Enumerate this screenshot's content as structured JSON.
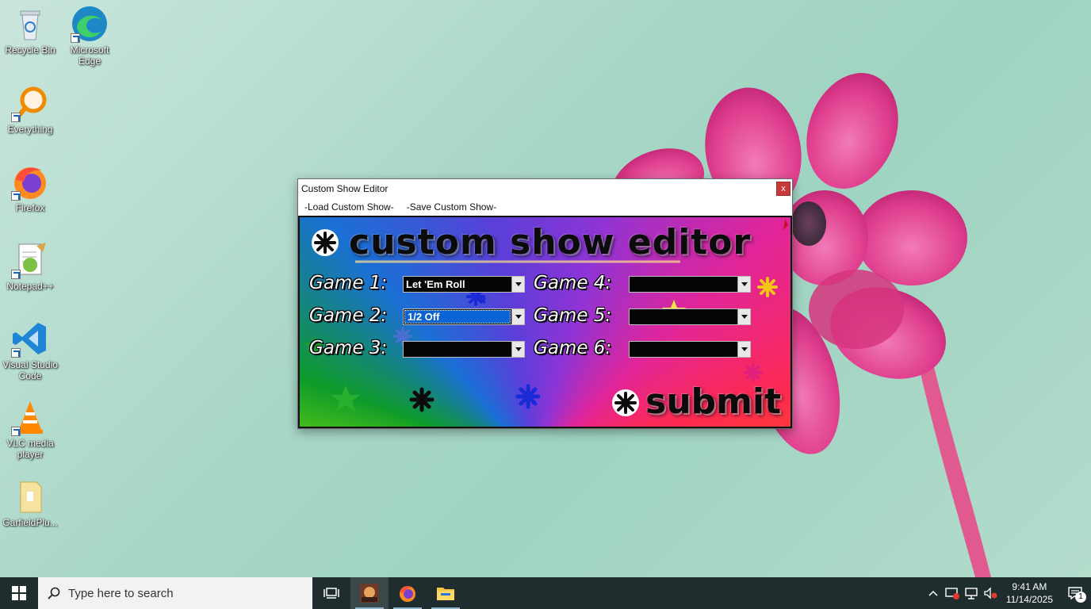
{
  "desktop": {
    "icons": [
      {
        "label": "Recycle Bin",
        "icon": "recycle-bin-icon"
      },
      {
        "label": "Microsoft Edge",
        "icon": "edge-icon"
      },
      {
        "label": "Everything",
        "icon": "everything-search-icon"
      },
      {
        "label": "Firefox",
        "icon": "firefox-icon"
      },
      {
        "label": "Notepad++",
        "icon": "notepad-plus-plus-icon"
      },
      {
        "label": "Visual Studio Code",
        "icon": "vscode-icon"
      },
      {
        "label": "VLC media player",
        "icon": "vlc-icon"
      },
      {
        "label": "GarfieldPlu...",
        "icon": "folder-icon"
      }
    ]
  },
  "window": {
    "title": "Custom Show Editor",
    "close_label": "x",
    "menu": [
      "-Load Custom Show-",
      "-Save Custom Show-"
    ],
    "panel": {
      "heading": "custom show editor",
      "games": [
        {
          "label": "Game 1:",
          "value": "Let 'Em Roll",
          "selected": false
        },
        {
          "label": "Game 2:",
          "value": "1/2 Off",
          "selected": true
        },
        {
          "label": "Game 3:",
          "value": "",
          "selected": false
        },
        {
          "label": "Game 4:",
          "value": "",
          "selected": false
        },
        {
          "label": "Game 5:",
          "value": "",
          "selected": false
        },
        {
          "label": "Game 6:",
          "value": "",
          "selected": false
        }
      ],
      "submit_label": "submit"
    }
  },
  "taskbar": {
    "search_placeholder": "Type here to search",
    "apps": [
      "task-view-icon",
      "garfield-app-icon",
      "firefox-icon",
      "file-explorer-icon"
    ],
    "time": "9:41 AM",
    "date": "11/14/2025",
    "notification_count": "1",
    "colors": {
      "taskbar": "#1f2d2e",
      "search": "#f2f2f2",
      "selection": "#0a64d6"
    }
  }
}
